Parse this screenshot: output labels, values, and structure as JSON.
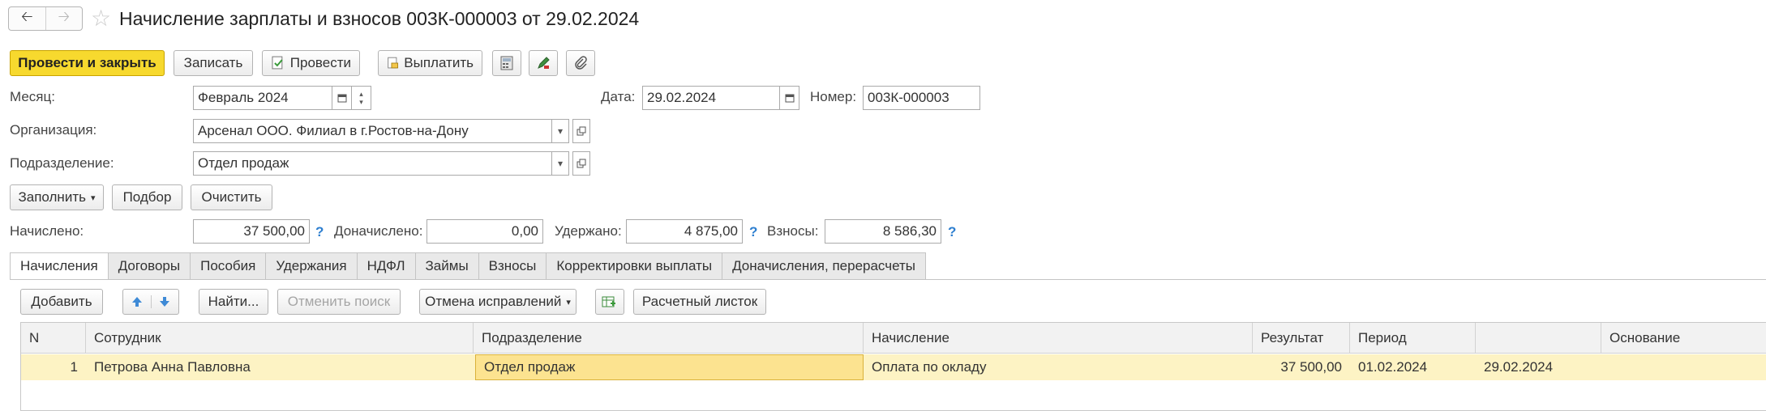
{
  "window": {
    "title": "Начисление зарплаты и взносов 003К-000003 от 29.02.2024"
  },
  "toolbar": {
    "post_close": "Провести и закрыть",
    "save": "Записать",
    "post": "Провести",
    "pay": "Выплатить"
  },
  "form": {
    "month_label": "Месяц:",
    "month_value": "Февраль 2024",
    "date_label": "Дата:",
    "date_value": "29.02.2024",
    "number_label": "Номер:",
    "number_value": "003К-000003",
    "org_label": "Организация:",
    "org_value": "Арсенал ООО. Филиал в г.Ростов-на-Дону",
    "dept_label": "Подразделение:",
    "dept_value": "Отдел продаж"
  },
  "actions": {
    "fill": "Заполнить",
    "select": "Подбор",
    "clear": "Очистить"
  },
  "totals": {
    "accrued_label": "Начислено:",
    "accrued_value": "37 500,00",
    "extra_label": "Доначислено:",
    "extra_value": "0,00",
    "withheld_label": "Удержано:",
    "withheld_value": "4 875,00",
    "contrib_label": "Взносы:",
    "contrib_value": "8 586,30",
    "help": "?"
  },
  "tabs": [
    "Начисления",
    "Договоры",
    "Пособия",
    "Удержания",
    "НДФЛ",
    "Займы",
    "Взносы",
    "Корректировки выплаты",
    "Доначисления, перерасчеты"
  ],
  "table_toolbar": {
    "add": "Добавить",
    "find": "Найти...",
    "cancel_search": "Отменить поиск",
    "cancel_fix": "Отмена исправлений",
    "payslip": "Расчетный листок"
  },
  "table": {
    "columns": [
      "N",
      "Сотрудник",
      "Подразделение",
      "Начисление",
      "Результат",
      "Период",
      "",
      "Основание"
    ],
    "rows": [
      [
        "1",
        "Петрова Анна Павловна",
        "Отдел продаж",
        "Оплата по окладу",
        "37 500,00",
        "01.02.2024",
        "29.02.2024",
        ""
      ]
    ]
  },
  "icons": {
    "back": "arrow-left-icon",
    "forward": "arrow-right-icon",
    "favorite": "star-icon",
    "post": "document-post-icon",
    "pay": "document-pay-icon",
    "calc": "calculator-icon",
    "edit": "pencil-icon",
    "attach": "paperclip-icon",
    "calendar": "calendar-icon",
    "open": "open-form-icon",
    "dropdown": "chevron-down-icon",
    "up": "arrow-up-icon",
    "down": "arrow-down-icon",
    "table_settings": "table-settings-icon"
  },
  "colors": {
    "primary_button": "#f7d92e",
    "selected_row": "#fdf3c4",
    "selected_cell": "#fce390",
    "help_blue": "#2e7fd0"
  }
}
